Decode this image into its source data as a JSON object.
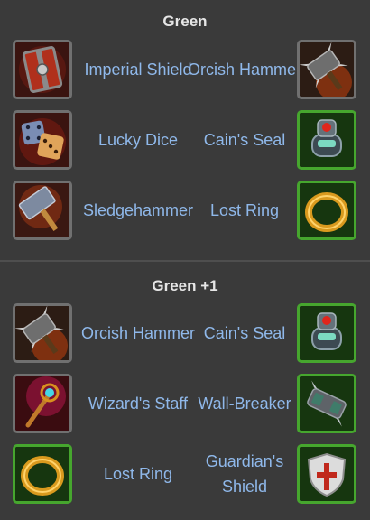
{
  "sections": [
    {
      "title": "Green",
      "rows": [
        {
          "left": {
            "icon": "imperial-shield-icon",
            "name": "Imperial Shield",
            "border": "#707070"
          },
          "right": {
            "icon": "orcish-hammer-icon",
            "name": "Orcish Hammer",
            "border": "#707070"
          }
        },
        {
          "left": {
            "icon": "lucky-dice-icon",
            "name": "Lucky Dice",
            "border": "#707070"
          },
          "right": {
            "icon": "cains-seal-icon",
            "name": "Cain's Seal",
            "border": "#46a62e"
          }
        },
        {
          "left": {
            "icon": "sledgehammer-icon",
            "name": "Sledgehammer",
            "border": "#707070"
          },
          "right": {
            "icon": "lost-ring-icon",
            "name": "Lost Ring",
            "border": "#46a62e"
          }
        }
      ]
    },
    {
      "title": "Green +1",
      "rows": [
        {
          "left": {
            "icon": "orcish-hammer-icon",
            "name": "Orcish Hammer",
            "border": "#707070"
          },
          "right": {
            "icon": "cains-seal-icon",
            "name": "Cain's Seal",
            "border": "#46a62e"
          }
        },
        {
          "left": {
            "icon": "wizards-staff-icon",
            "name": "Wizard's Staff",
            "border": "#707070"
          },
          "right": {
            "icon": "wall-breaker-icon",
            "name": "Wall-Breaker",
            "border": "#46a62e"
          }
        },
        {
          "left": {
            "icon": "lost-ring-icon",
            "name": "Lost Ring",
            "border": "#46a62e"
          },
          "right": {
            "icon": "guardians-shield-icon",
            "name": "Guardian's Shield",
            "border": "#46a62e"
          }
        }
      ]
    }
  ]
}
